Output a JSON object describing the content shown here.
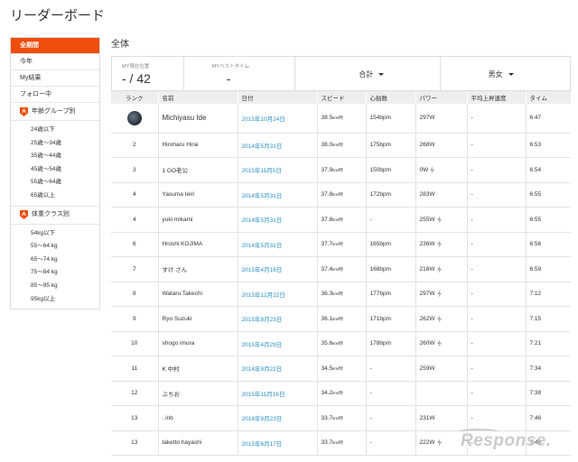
{
  "page": {
    "title": "リーダーボード",
    "section_title": "全体"
  },
  "sidebar": {
    "top_items": [
      {
        "label": "全期間",
        "active": true
      },
      {
        "label": "今年",
        "active": false
      },
      {
        "label": "My結果",
        "active": false
      },
      {
        "label": "フォロー中",
        "active": false
      }
    ],
    "age_group": {
      "label": "年齢グループ別",
      "items": [
        "24歳以下",
        "25歳〜34歳",
        "35歳〜44歳",
        "45歳〜54歳",
        "55歳〜64歳",
        "65歳以上"
      ]
    },
    "weight_class": {
      "label": "体重クラス別",
      "items": [
        "54kg以下",
        "55〜64 kg",
        "65〜74 kg",
        "75〜84 kg",
        "85〜95 kg",
        "95kg以上"
      ]
    }
  },
  "summary": {
    "my_rank_label": "MY現在位置",
    "my_rank_value": "- / 42",
    "my_best_label": "MYベストタイム",
    "my_best_value": "-",
    "filter_total": "合計",
    "filter_gender": "男女"
  },
  "table": {
    "headers": {
      "rank": "ランク",
      "name": "名前",
      "date": "日付",
      "speed": "スピード",
      "heart_rate": "心拍数",
      "power": "パワー",
      "vam": "平均上昇速度",
      "time": "タイム"
    },
    "rows": [
      {
        "rank": "",
        "name": "Michiyasu Ide",
        "date": "2015年10月24日",
        "speed": "38.5",
        "speed_unit": "km/時",
        "hr": "154bpm",
        "power": "297",
        "power_unit": "W",
        "estimated": false,
        "vam": "-",
        "time": "6:47",
        "avatar": true
      },
      {
        "rank": "2",
        "name": "Hiroharu Hirai",
        "date": "2014年5月31日",
        "speed": "38.0",
        "speed_unit": "km/時",
        "hr": "175bpm",
        "power": "268",
        "power_unit": "W",
        "estimated": false,
        "vam": "-",
        "time": "6:53",
        "avatar": false
      },
      {
        "rank": "3",
        "name": "1 GO老公",
        "date": "2015年11月5日",
        "speed": "37.9",
        "speed_unit": "km/時",
        "hr": "150bpm",
        "power": "0",
        "power_unit": "W",
        "estimated": true,
        "vam": "-",
        "time": "6:54",
        "avatar": false
      },
      {
        "rank": "4",
        "name": "Yasuma Ieiri",
        "date": "2014年5月31日",
        "speed": "37.8",
        "speed_unit": "km/時",
        "hr": "172bpm",
        "power": "283",
        "power_unit": "W",
        "estimated": false,
        "vam": "-",
        "time": "6:55",
        "avatar": false
      },
      {
        "rank": "4",
        "name": "yuki mikami",
        "date": "2014年5月31日",
        "speed": "37.8",
        "speed_unit": "km/時",
        "hr": "-",
        "power": "255",
        "power_unit": "W",
        "estimated": true,
        "vam": "-",
        "time": "6:55",
        "avatar": false
      },
      {
        "rank": "6",
        "name": "Hroshi KOJIMA",
        "date": "2014年5月31日",
        "speed": "37.7",
        "speed_unit": "km/時",
        "hr": "165bpm",
        "power": "236",
        "power_unit": "W",
        "estimated": true,
        "vam": "-",
        "time": "6:56",
        "avatar": false
      },
      {
        "rank": "7",
        "name": "すけ さん",
        "date": "2015年4月16日",
        "speed": "37.4",
        "speed_unit": "km/時",
        "hr": "168bpm",
        "power": "216",
        "power_unit": "W",
        "estimated": true,
        "vam": "-",
        "time": "6:59",
        "avatar": false
      },
      {
        "rank": "8",
        "name": "Wataru Takechi",
        "date": "2015年12月22日",
        "speed": "36.3",
        "speed_unit": "km/時",
        "hr": "177bpm",
        "power": "297",
        "power_unit": "W",
        "estimated": true,
        "vam": "-",
        "time": "7:12",
        "avatar": false
      },
      {
        "rank": "9",
        "name": "Ryo Suzuki",
        "date": "2015年8月23日",
        "speed": "36.1",
        "speed_unit": "km/時",
        "hr": "171bpm",
        "power": "262",
        "power_unit": "W",
        "estimated": true,
        "vam": "-",
        "time": "7:15",
        "avatar": false
      },
      {
        "rank": "10",
        "name": "shogo imura",
        "date": "2015年4月29日",
        "speed": "35.6",
        "speed_unit": "km/時",
        "hr": "178bpm",
        "power": "260",
        "power_unit": "W",
        "estimated": true,
        "vam": "-",
        "time": "7:21",
        "avatar": false
      },
      {
        "rank": "11",
        "name": "K 中村",
        "date": "2014年9月22日",
        "speed": "34.5",
        "speed_unit": "km/時",
        "hr": "-",
        "power": "259",
        "power_unit": "W",
        "estimated": false,
        "vam": "-",
        "time": "7:34",
        "avatar": false
      },
      {
        "rank": "12",
        "name": "ぶちお",
        "date": "2015年11月16日",
        "speed": "34.2",
        "speed_unit": "km/時",
        "hr": "-",
        "power": "",
        "power_unit": "",
        "estimated": false,
        "vam": "-",
        "time": "7:38",
        "avatar": false
      },
      {
        "rank": "13",
        "name": ". inb",
        "date": "2014年9月23日",
        "speed": "33.7",
        "speed_unit": "km/時",
        "hr": "-",
        "power": "231",
        "power_unit": "W",
        "estimated": false,
        "vam": "-",
        "time": "7:46",
        "avatar": false
      },
      {
        "rank": "13",
        "name": "taketto hayashi",
        "date": "2015年6月17日",
        "speed": "33.7",
        "speed_unit": "km/時",
        "hr": "-",
        "power": "222",
        "power_unit": "W",
        "estimated": true,
        "vam": "-",
        "time": "7:46",
        "avatar": false
      }
    ]
  },
  "watermark": {
    "text": "Response."
  },
  "colors": {
    "accent": "#ef4d0c",
    "link": "#2a8fc5",
    "header_bg": "#eeeeee"
  }
}
